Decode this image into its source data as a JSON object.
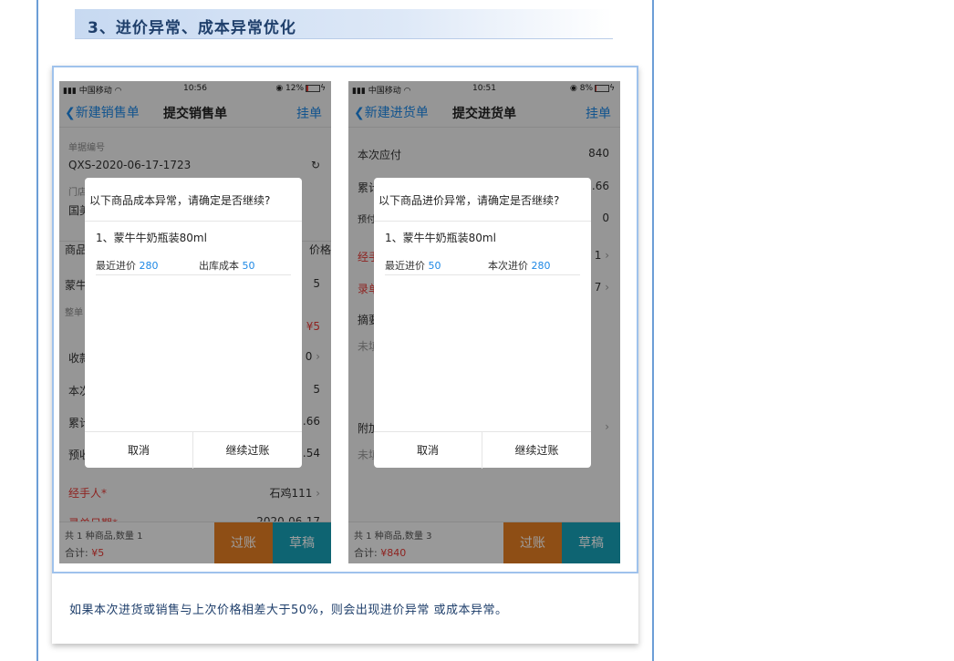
{
  "section": {
    "heading": "3、进价异常、成本异常优化"
  },
  "caption": "如果本次进货或销售与上次价格相差大于50%，则会出现进价异常 或成本异常。",
  "colors": {
    "accent": "#1e88e5",
    "post": "#e67e22",
    "draft": "#17a2b8",
    "danger": "#e53935"
  },
  "phone_left": {
    "status": {
      "carrier": "中国移动",
      "time": "10:56",
      "battery": "12%",
      "battery_level": 0.12
    },
    "nav": {
      "back": "新建销售单",
      "title": "提交销售单",
      "right": "挂单"
    },
    "doc_no_label": "单据编号",
    "doc_no": "QXS-2020-06-17-1723",
    "store_label": "门店",
    "store_value": "国美",
    "col_product": "商品",
    "col_price": "价格",
    "product_name": "蒙牛",
    "product_price": "5",
    "discount_label": "整单",
    "discount_value": "¥5",
    "receipt_label": "收款",
    "receipt_value": "0",
    "this_label": "本次",
    "this_value": "5",
    "accum_label": "累计",
    "accum_value": ".66",
    "prepay_label": "预收",
    "prepay_value": ".54",
    "handler_label": "经手人*",
    "handler_value": "石鸡111",
    "date_label": "录单日期*",
    "date_value": "2020-06-17",
    "summary": "共 1 种商品,数量 1",
    "total_label": "合计:",
    "total_value": "¥5",
    "post": "过账",
    "draft": "草稿",
    "dialog": {
      "title": "以下商品成本异常，请确定是否继续?",
      "item": "1、蒙牛牛奶瓶装80ml",
      "p1_label": "最近进价",
      "p1_value": "280",
      "p2_label": "出库成本",
      "p2_value": "50",
      "cancel": "取消",
      "confirm": "继续过账"
    }
  },
  "phone_right": {
    "status": {
      "carrier": "中国移动",
      "time": "10:51",
      "battery": "8%",
      "battery_level": 0.08
    },
    "nav": {
      "back": "新建进货单",
      "title": "提交进货单",
      "right": "挂单"
    },
    "payable_label": "本次应付",
    "payable_value": "840",
    "accum_label": "累计",
    "accum_value": ".66",
    "prepay_label": "预付",
    "prepay_value": "0",
    "handler_label": "经手",
    "handler_value": "1",
    "record_label": "录单",
    "record_value": "7",
    "abstract_label": "摘要",
    "abstract_placeholder": "未填",
    "attach_label": "附加",
    "attach_placeholder": "未填",
    "summary": "共 1 种商品,数量 3",
    "total_label": "合计:",
    "total_value": "¥840",
    "post": "过账",
    "draft": "草稿",
    "dialog": {
      "title": "以下商品进价异常，请确定是否继续?",
      "item": "1、蒙牛牛奶瓶装80ml",
      "p1_label": "最近进价",
      "p1_value": "50",
      "p2_label": "本次进价",
      "p2_value": "280",
      "cancel": "取消",
      "confirm": "继续过账"
    }
  }
}
